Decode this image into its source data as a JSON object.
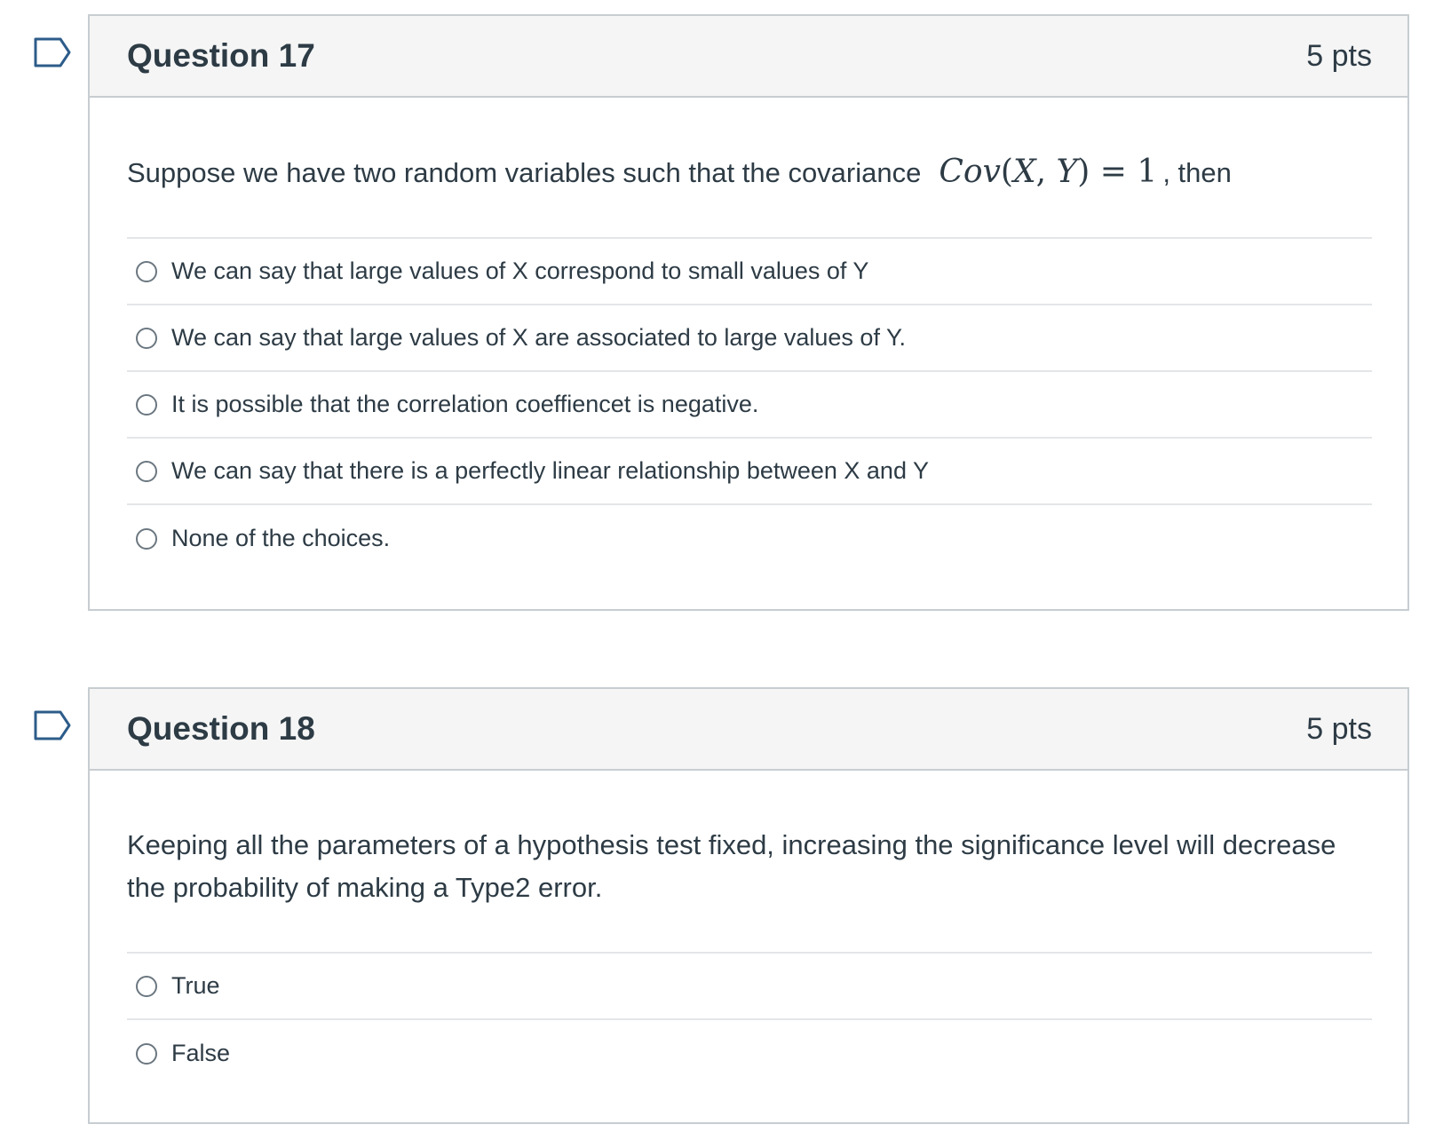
{
  "questions": [
    {
      "title": "Question 17",
      "points": "5 pts",
      "text_before": "Suppose we have two random variables such that the covariance",
      "math": {
        "fn": "Cov",
        "open": "(",
        "x": "X",
        "comma": ",",
        "y": "Y",
        "close": ")",
        "eq": "=",
        "val": "1"
      },
      "text_after": ", then",
      "answers": [
        "We can say that large values of X correspond to small values of Y",
        "We can say that large values of X are associated to large values of Y.",
        "It is possible that the correlation coeffiencet is negative.",
        "We can say that there is a perfectly linear relationship between X and Y",
        "None of the choices."
      ]
    },
    {
      "title": "Question 18",
      "points": "5 pts",
      "text": "Keeping all the parameters of a hypothesis test fixed, increasing the significance level will decrease the probability of making a Type2 error.",
      "answers": [
        "True",
        "False"
      ]
    }
  ],
  "colors": {
    "header_bg": "#f5f5f5",
    "border": "#c7cdd1",
    "text": "#2d3b45",
    "flag": "#2d5c8a"
  },
  "icons": {
    "flag": "flag-outline-icon",
    "radio": "radio-unchecked-icon"
  }
}
